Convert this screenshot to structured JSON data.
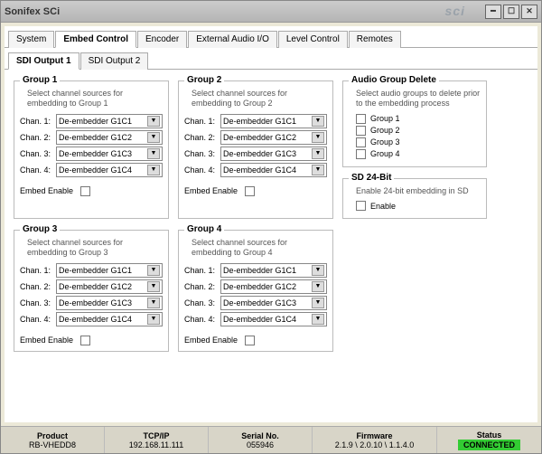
{
  "window": {
    "title": "Sonifex SCi",
    "logo": "sci"
  },
  "tabs": {
    "main": [
      {
        "label": "System"
      },
      {
        "label": "Embed Control"
      },
      {
        "label": "Encoder"
      },
      {
        "label": "External Audio I/O"
      },
      {
        "label": "Level Control"
      },
      {
        "label": "Remotes"
      }
    ],
    "active_main": 1,
    "sub": [
      {
        "label": "SDI Output 1"
      },
      {
        "label": "SDI Output 2"
      }
    ],
    "active_sub": 0
  },
  "groups": [
    {
      "title": "Group 1",
      "desc": "Select channel sources for embedding to Group 1",
      "channels": [
        {
          "label": "Chan. 1:",
          "value": "De-embedder G1C1"
        },
        {
          "label": "Chan. 2:",
          "value": "De-embedder G1C2"
        },
        {
          "label": "Chan. 3:",
          "value": "De-embedder G1C3"
        },
        {
          "label": "Chan. 4:",
          "value": "De-embedder G1C4"
        }
      ],
      "embed_label": "Embed Enable",
      "embed_checked": false
    },
    {
      "title": "Group 2",
      "desc": "Select channel sources for embedding to Group 2",
      "channels": [
        {
          "label": "Chan. 1:",
          "value": "De-embedder G1C1"
        },
        {
          "label": "Chan. 2:",
          "value": "De-embedder G1C2"
        },
        {
          "label": "Chan. 3:",
          "value": "De-embedder G1C3"
        },
        {
          "label": "Chan. 4:",
          "value": "De-embedder G1C4"
        }
      ],
      "embed_label": "Embed Enable",
      "embed_checked": false
    },
    {
      "title": "Group 3",
      "desc": "Select channel sources for embedding to Group 3",
      "channels": [
        {
          "label": "Chan. 1:",
          "value": "De-embedder G1C1"
        },
        {
          "label": "Chan. 2:",
          "value": "De-embedder G1C2"
        },
        {
          "label": "Chan. 3:",
          "value": "De-embedder G1C3"
        },
        {
          "label": "Chan. 4:",
          "value": "De-embedder G1C4"
        }
      ],
      "embed_label": "Embed Enable",
      "embed_checked": false
    },
    {
      "title": "Group 4",
      "desc": "Select channel sources for embedding to Group 4",
      "channels": [
        {
          "label": "Chan. 1:",
          "value": "De-embedder G1C1"
        },
        {
          "label": "Chan. 2:",
          "value": "De-embedder G1C2"
        },
        {
          "label": "Chan. 3:",
          "value": "De-embedder G1C3"
        },
        {
          "label": "Chan. 4:",
          "value": "De-embedder G1C4"
        }
      ],
      "embed_label": "Embed Enable",
      "embed_checked": false
    }
  ],
  "audio_group_delete": {
    "title": "Audio Group Delete",
    "desc": "Select audio groups to delete prior to the embedding process",
    "items": [
      {
        "label": "Group 1"
      },
      {
        "label": "Group 2"
      },
      {
        "label": "Group 3"
      },
      {
        "label": "Group 4"
      }
    ]
  },
  "sd24": {
    "title": "SD 24-Bit",
    "desc": "Enable 24-bit embedding in SD",
    "enable_label": "Enable"
  },
  "status": {
    "product": {
      "head": "Product",
      "val": "RB-VHEDD8"
    },
    "tcpip": {
      "head": "TCP/IP",
      "val": "192.168.11.111"
    },
    "serial": {
      "head": "Serial No.",
      "val": "055946"
    },
    "firmware": {
      "head": "Firmware",
      "val": "2.1.9 \\ 2.0.10 \\ 1.1.4.0"
    },
    "conn": {
      "head": "Status",
      "val": "CONNECTED"
    }
  }
}
